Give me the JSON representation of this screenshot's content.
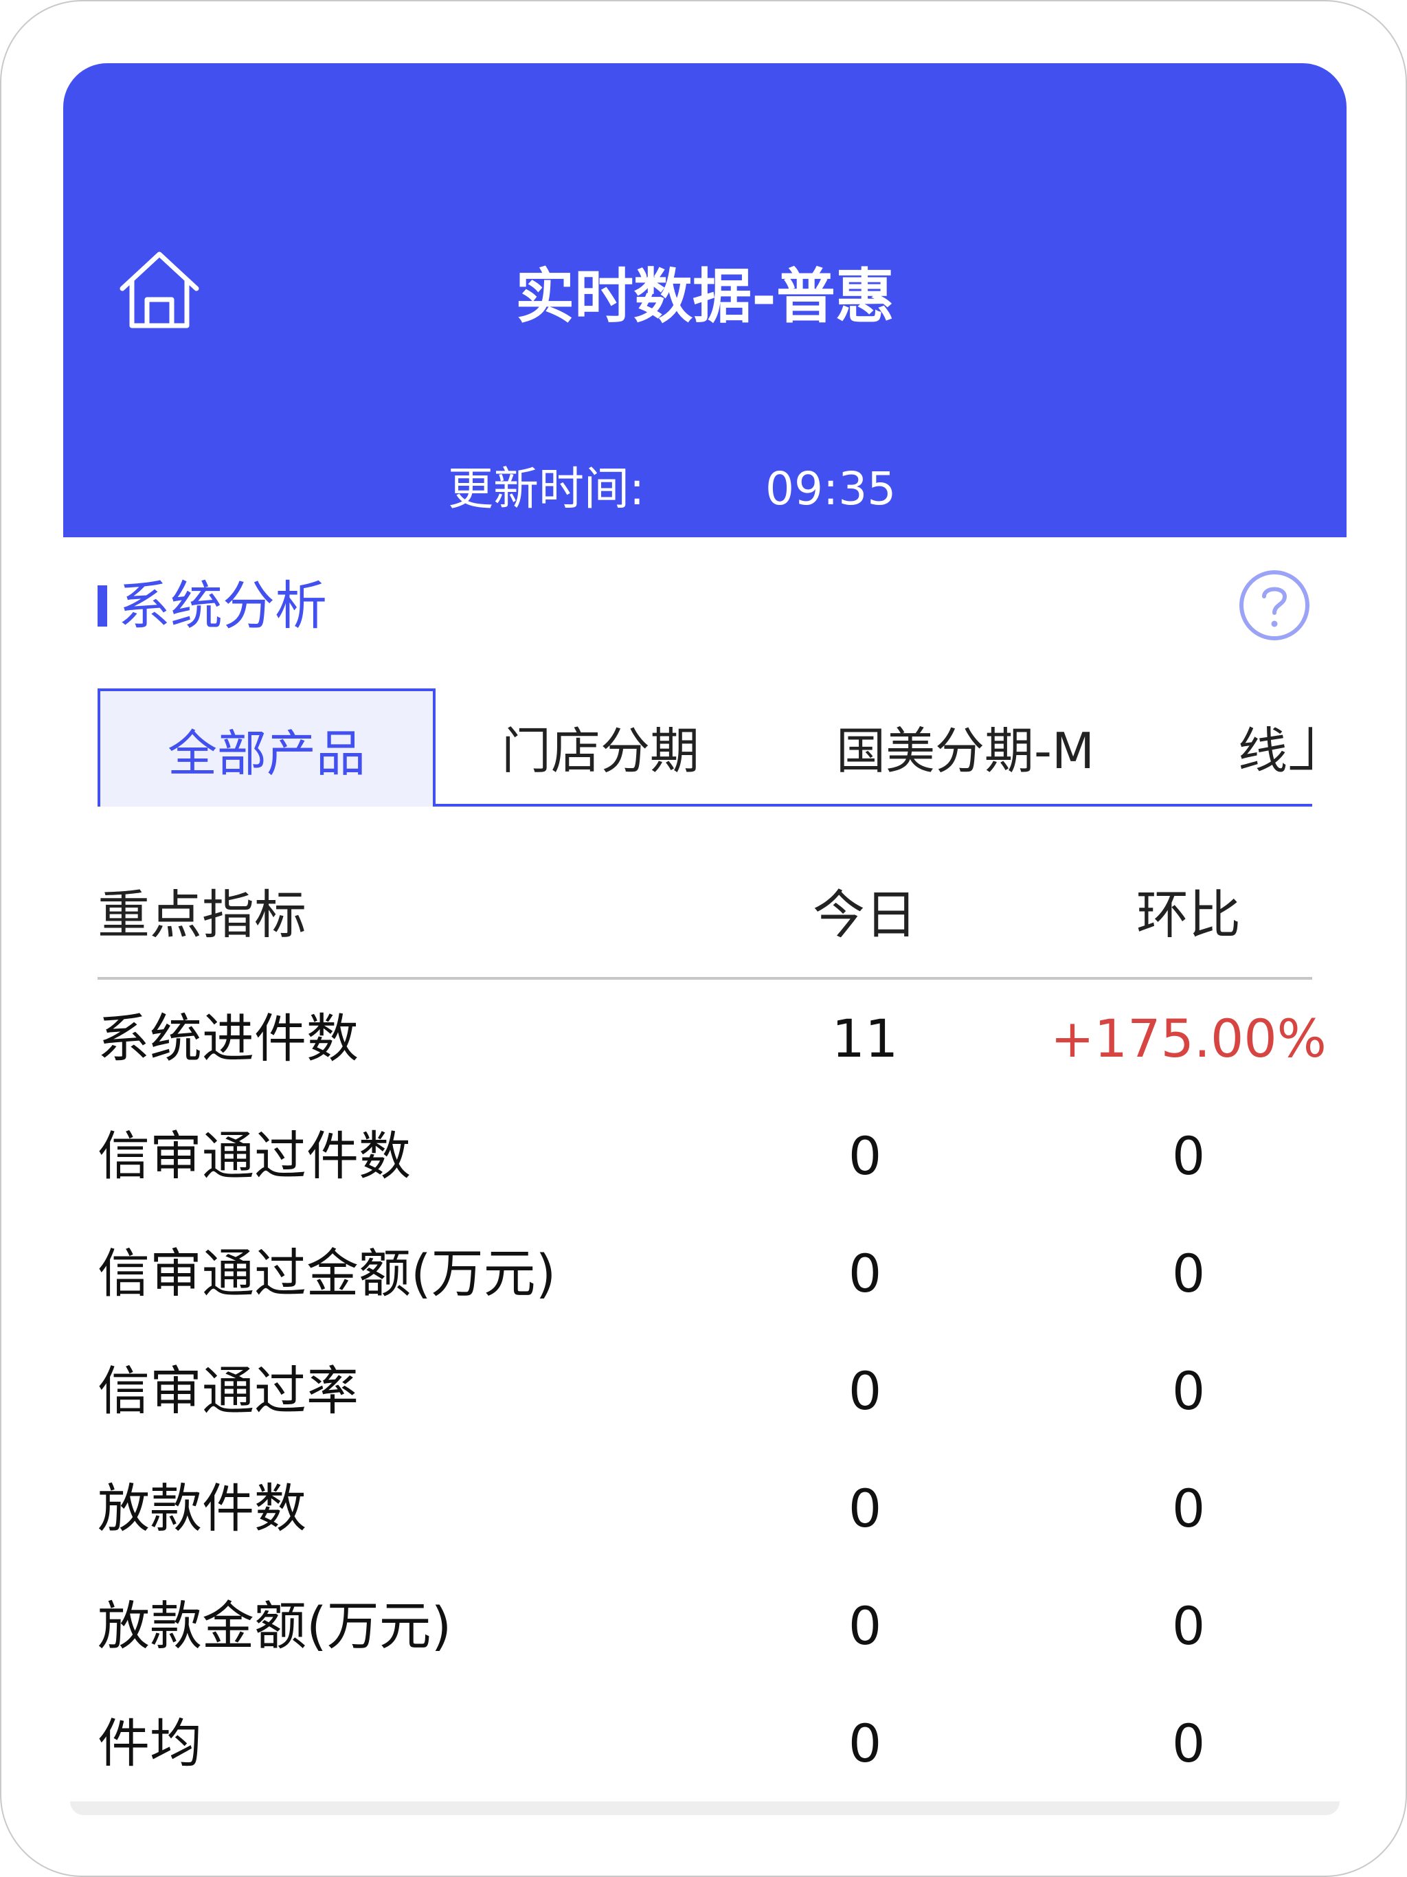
{
  "header": {
    "title": "实时数据-普惠",
    "update_label": "更新时间:",
    "update_time": "09:35",
    "home_icon": "home-icon"
  },
  "section": {
    "title": "系统分析",
    "help_icon": "help-circle-icon"
  },
  "tabs": [
    {
      "label": "全部产品",
      "active": true
    },
    {
      "label": "门店分期",
      "active": false
    },
    {
      "label": "国美分期-M",
      "active": false
    },
    {
      "label": "线上",
      "active": false
    }
  ],
  "table": {
    "headers": [
      "重点指标",
      "今日",
      "环比"
    ],
    "rows": [
      {
        "metric": "系统进件数",
        "today": "11",
        "mom": "+175.00%"
      },
      {
        "metric": "信审通过件数",
        "today": "0",
        "mom": "0"
      },
      {
        "metric": "信审通过金额(万元)",
        "today": "0",
        "mom": "0"
      },
      {
        "metric": "信审通过率",
        "today": "0",
        "mom": "0"
      },
      {
        "metric": "放款件数",
        "today": "0",
        "mom": "0"
      },
      {
        "metric": "放款金额(万元)",
        "today": "0",
        "mom": "0"
      },
      {
        "metric": "件均",
        "today": "0",
        "mom": "0"
      }
    ]
  },
  "colors": {
    "accent": "#4350f0",
    "increase": "#d64541",
    "tab_active_bg": "#eef1fd"
  }
}
